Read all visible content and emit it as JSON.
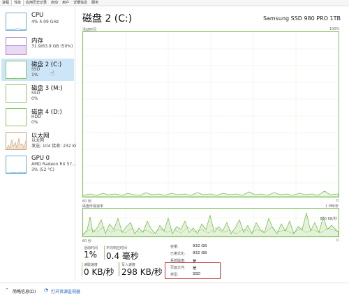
{
  "tabs": [
    "进程",
    "性能",
    "应用历史记录",
    "启动",
    "用户",
    "详细信息",
    "服务"
  ],
  "active_tab": 1,
  "sidebar": {
    "items": [
      {
        "title": "CPU",
        "line1": "4% 4.09 GHz",
        "line2": ""
      },
      {
        "title": "内存",
        "line1": "31.9/63.9 GB (50%)",
        "line2": ""
      },
      {
        "title": "磁盘 2 (C:)",
        "line1": "SSD",
        "line2": "1%"
      },
      {
        "title": "磁盘 3 (M:)",
        "line1": "SSD",
        "line2": "0%"
      },
      {
        "title": "磁盘 4 (D:)",
        "line1": "HDD",
        "line2": "0%"
      },
      {
        "title": "以太网",
        "line1": "以太网",
        "line2": "发送: 104 接收: 232 Ki"
      },
      {
        "title": "GPU 0",
        "line1": "AMD Radeon RX 57...",
        "line2": "3% (52 °C)"
      }
    ]
  },
  "main": {
    "title": "磁盘 2 (C:)",
    "model": "Samsung SSD 980 PRO 1TB",
    "graph1": {
      "top_left": "活动时间",
      "top_right": "100%",
      "bottom_left": "60 秒",
      "bottom_right": "0"
    },
    "graph2": {
      "top_left": "磁盘传输速率",
      "top_right": "1 MB/秒",
      "mid_right": "800 KB/秒",
      "bottom_left": "60 秒",
      "bottom_right": "0"
    },
    "stats": {
      "active_time_label": "活动时间",
      "active_time_value": "1%",
      "response_label": "平均响应时间",
      "response_value": "0.4 毫秒",
      "read_label": "读取速度",
      "read_value": "0 KB/秒",
      "write_label": "写入速度",
      "write_value": "298 KB/秒"
    },
    "properties": [
      {
        "label": "容量:",
        "value": "932 GB"
      },
      {
        "label": "已格式化:",
        "value": "932 GB"
      },
      {
        "label": "系统磁盘:",
        "value": "是"
      },
      {
        "label": "页面文件:",
        "value": "是"
      },
      {
        "label": "类型:",
        "value": "SSD"
      }
    ]
  },
  "footer": {
    "brief_label": "简略信息(D)",
    "monitor_label": "打开资源监视器"
  },
  "colors": {
    "disk_green": "#7cbf55",
    "selected_bg": "#cde6f7",
    "highlight_red": "#b73a3a",
    "link_blue": "#1a5fb4"
  }
}
